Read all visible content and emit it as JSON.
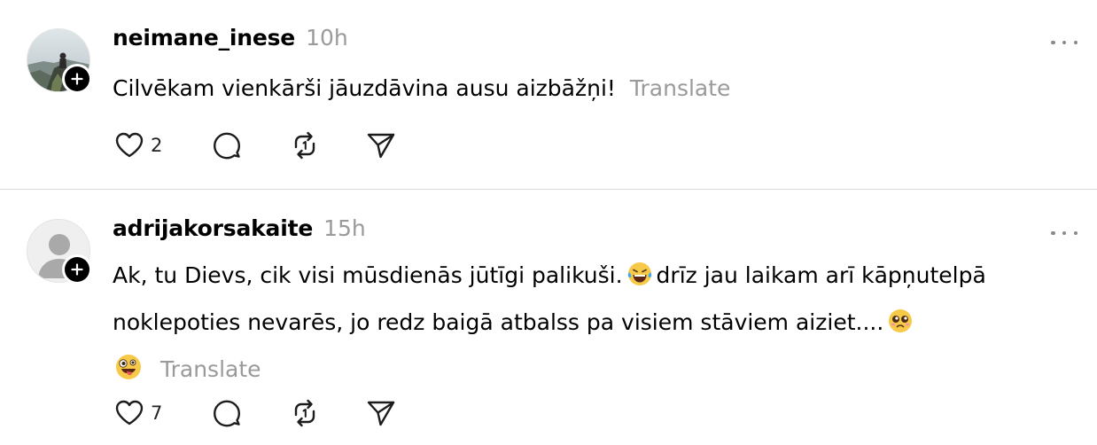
{
  "posts": [
    {
      "username": "neimane_inese",
      "timestamp": "10h",
      "text": "Cilvēkam vienkārši jāuzdāvina ausu aizbāžņi!",
      "translate_label": "Translate",
      "likes": "2",
      "avatar": "photo-avatar"
    },
    {
      "username": "adrijakorsakaite",
      "timestamp": "15h",
      "text_part1": "Ak, tu Dievs, cik visi mūsdienās jūtīgi palikuši.",
      "text_part2": "drīz jau laikam arī kāpņutelpā noklepoties nevarēs, jo redz baigā atbalss pa visiem stāviem aiziet....",
      "translate_label": "Translate",
      "likes": "7",
      "avatar": "default-avatar"
    }
  ],
  "icons": {
    "like": "heart-icon",
    "reply": "comment-icon",
    "repost": "repost-icon",
    "share": "send-icon",
    "more": "more-icon",
    "follow": "plus-icon"
  },
  "colors": {
    "text": "#000000",
    "muted": "#9a9a9a",
    "divider": "#d9d9d9"
  }
}
